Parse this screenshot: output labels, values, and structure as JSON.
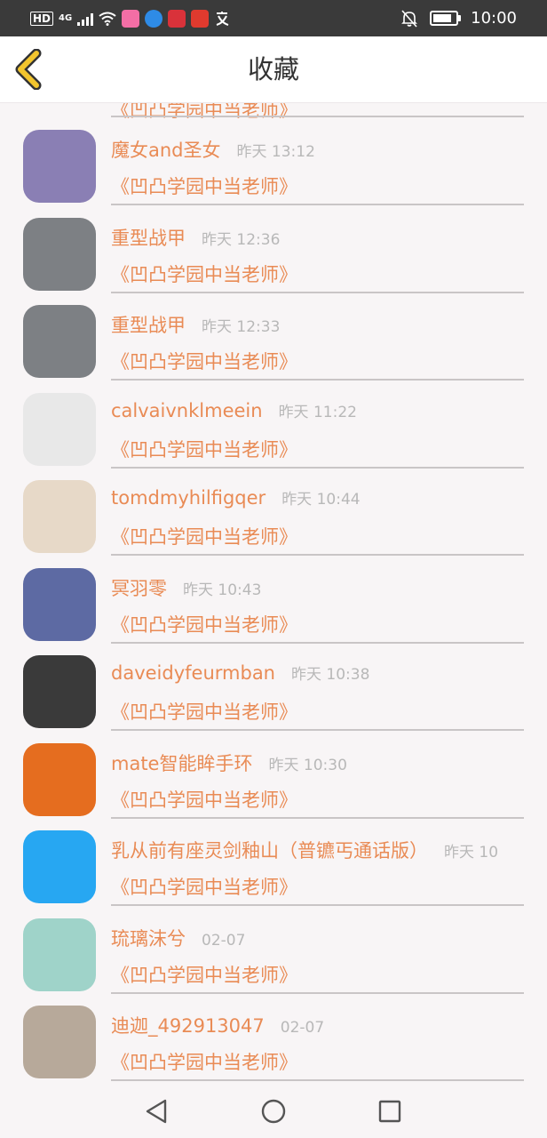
{
  "status_bar": {
    "network_hd": "HD",
    "network_4g": "4G",
    "time": "10:00"
  },
  "header": {
    "title": "收藏"
  },
  "list": {
    "partial_book": "《凹凸学园中当老师》",
    "items": [
      {
        "name": "魔女and圣女",
        "time": "昨天 13:12",
        "book": "《凹凸学园中当老师》",
        "avatar_color": "#8a7fb4"
      },
      {
        "name": "重型战甲",
        "time": "昨天 12:36",
        "book": "《凹凸学园中当老师》",
        "avatar_color": "#7d8084"
      },
      {
        "name": "重型战甲",
        "time": "昨天 12:33",
        "book": "《凹凸学园中当老师》",
        "avatar_color": "#7d8084"
      },
      {
        "name": "calvaivnklmeein",
        "time": "昨天 11:22",
        "book": "《凹凸学园中当老师》",
        "avatar_color": "#e8e8e8"
      },
      {
        "name": "tomdmyhilfigqer",
        "time": "昨天 10:44",
        "book": "《凹凸学园中当老师》",
        "avatar_color": "#e7d9c8"
      },
      {
        "name": "冥羽零",
        "time": "昨天 10:43",
        "book": "《凹凸学园中当老师》",
        "avatar_color": "#5d6aa3"
      },
      {
        "name": "daveidyfeurmban",
        "time": "昨天 10:38",
        "book": "《凹凸学园中当老师》",
        "avatar_color": "#3a3a3a"
      },
      {
        "name": "mate智能眸手环",
        "time": "昨天 10:30",
        "book": "《凹凸学园中当老师》",
        "avatar_color": "#e56d1f"
      },
      {
        "name": "乳从前有座灵剑釉山（普镳丐通话版）",
        "time": "昨天 10",
        "book": "《凹凸学园中当老师》",
        "avatar_color": "#27a7f2"
      },
      {
        "name": "琉璃沫兮",
        "time": "02-07",
        "book": "《凹凸学园中当老师》",
        "avatar_color": "#9fd3c9"
      },
      {
        "name": "迪迦_492913047",
        "time": "02-07",
        "book": "《凹凸学园中当老师》",
        "avatar_color": "#b7a99a"
      }
    ]
  },
  "colors": {
    "accent": "#e98b55",
    "time_gray": "#b8b8b8",
    "back_yellow": "#f2c52e"
  }
}
